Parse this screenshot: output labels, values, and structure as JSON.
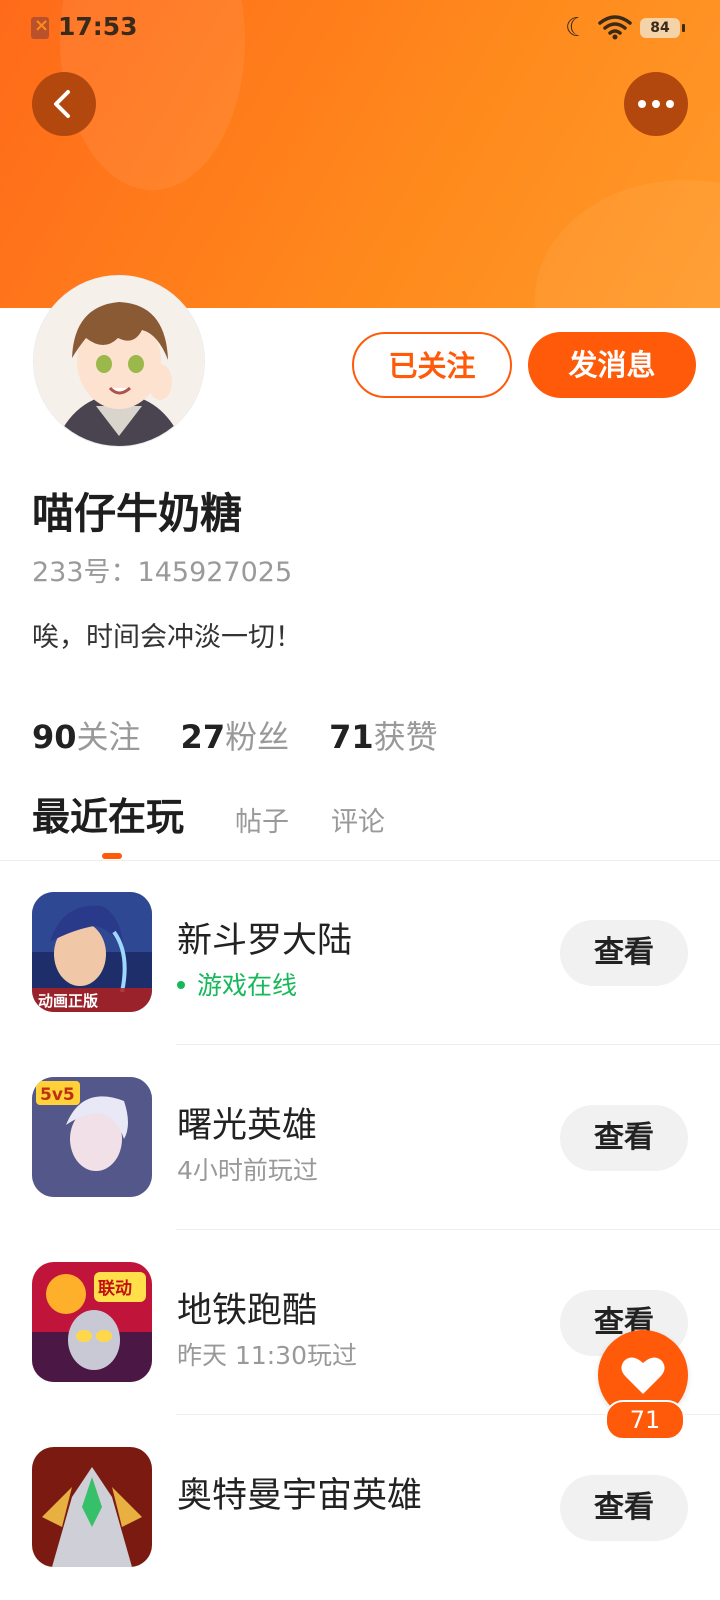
{
  "status_bar": {
    "time": "17:53",
    "battery": "84"
  },
  "header": {
    "background_gradient": [
      "#ff6a1a",
      "#ff9a2a"
    ]
  },
  "profile": {
    "name": "喵仔牛奶糖",
    "id_label": "233号：145927025",
    "bio": "唉，时间会冲淡一切！",
    "follow_label": "已关注",
    "message_label": "发消息",
    "stats": [
      {
        "num": "90",
        "label": "关注"
      },
      {
        "num": "27",
        "label": "粉丝"
      },
      {
        "num": "71",
        "label": "获赞"
      }
    ]
  },
  "tabs": {
    "active": "最近在玩",
    "posts": "帖子",
    "comments": "评论"
  },
  "games": [
    {
      "name": "新斗罗大陆",
      "status": "游戏在线",
      "online": true,
      "action": "查看",
      "icon_badge": "动画正版"
    },
    {
      "name": "曙光英雄",
      "status": "4小时前玩过",
      "online": false,
      "action": "查看",
      "icon_badge": "5v5"
    },
    {
      "name": "地铁跑酷",
      "status": "昨天 11:30玩过",
      "online": false,
      "action": "查看",
      "icon_badge": "联动"
    },
    {
      "name": "奥特曼宇宙英雄",
      "status": "",
      "online": false,
      "action": "查看",
      "icon_badge": ""
    }
  ],
  "like_fab": {
    "count": "71"
  },
  "colors": {
    "accent": "#ff5a0a",
    "online": "#17b85a"
  }
}
